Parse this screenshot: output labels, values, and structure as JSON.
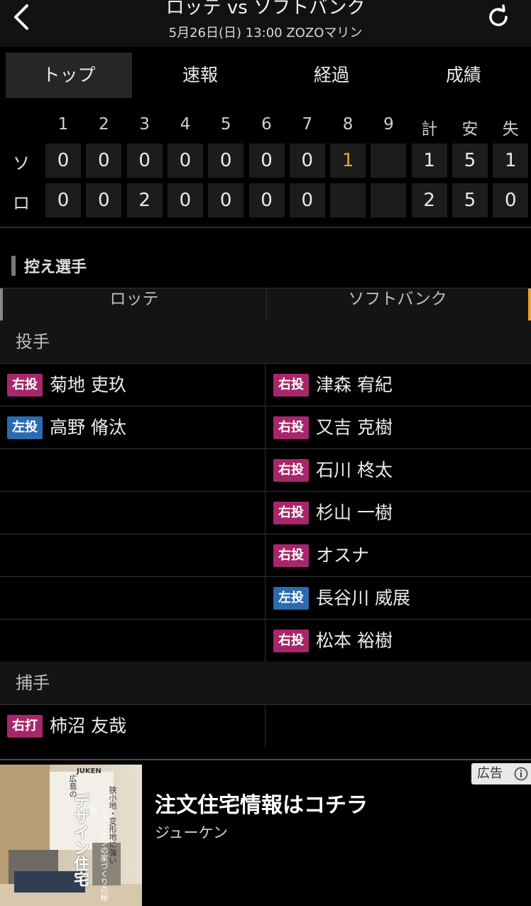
{
  "header": {
    "title": "ロッテ vs ソフトバンク",
    "subtitle": "5月26日(日) 13:00 ZOZOマリン"
  },
  "tabs": [
    {
      "label": "トップ",
      "active": true
    },
    {
      "label": "速報",
      "active": false
    },
    {
      "label": "経過",
      "active": false
    },
    {
      "label": "成績",
      "active": false
    }
  ],
  "scoreboard": {
    "columns": [
      "1",
      "2",
      "3",
      "4",
      "5",
      "6",
      "7",
      "8",
      "9",
      "計",
      "安",
      "失"
    ],
    "rows": [
      {
        "team": "ソ",
        "innings": [
          "0",
          "0",
          "0",
          "0",
          "0",
          "0",
          "0",
          "1",
          ""
        ],
        "total": "1",
        "hits": "5",
        "errors": "1"
      },
      {
        "team": "ロ",
        "innings": [
          "0",
          "0",
          "2",
          "0",
          "0",
          "0",
          "0",
          "",
          ""
        ],
        "total": "2",
        "hits": "5",
        "errors": "0"
      }
    ],
    "highlight_color": "#f0a030"
  },
  "bench": {
    "section_title": "控え選手",
    "teams": {
      "left": "ロッテ",
      "right": "ソフトバンク"
    },
    "pitchers_label": "投手",
    "catchers_label": "捕手",
    "pitchers": [
      {
        "left": {
          "badge": "右投",
          "name": "菊地 吏玖",
          "type": "r"
        },
        "right": {
          "badge": "右投",
          "name": "津森 宥紀",
          "type": "r"
        }
      },
      {
        "left": {
          "badge": "左投",
          "name": "高野 脩汰",
          "type": "l"
        },
        "right": {
          "badge": "右投",
          "name": "又吉 克樹",
          "type": "r"
        }
      },
      {
        "left": null,
        "right": {
          "badge": "右投",
          "name": "石川 柊太",
          "type": "r"
        }
      },
      {
        "left": null,
        "right": {
          "badge": "右投",
          "name": "杉山 一樹",
          "type": "r"
        }
      },
      {
        "left": null,
        "right": {
          "badge": "右投",
          "name": "オスナ",
          "type": "r"
        }
      },
      {
        "left": null,
        "right": {
          "badge": "左投",
          "name": "長谷川 威展",
          "type": "l"
        }
      },
      {
        "left": null,
        "right": {
          "badge": "右投",
          "name": "松本 裕樹",
          "type": "r"
        }
      }
    ],
    "catchers": [
      {
        "left": {
          "badge": "右打",
          "name": "柿沼 友哉",
          "type": "r"
        },
        "right": null
      }
    ]
  },
  "ad": {
    "title": "注文住宅情報はコチラ",
    "sponsor": "ジューケン",
    "badge": "広告",
    "image_lines": [
      "広島の",
      "デザイン住宅",
      "狭小地・変形地に強い",
      "ジューケンの家づくりの秘密",
      "JUKEN"
    ]
  },
  "icons": {
    "back": "chevron-left-icon",
    "refresh": "refresh-icon",
    "info": "info-icon"
  },
  "colors": {
    "right_badge": "#a8266b",
    "left_badge": "#2b6bb0",
    "accent": "#f0a030"
  }
}
